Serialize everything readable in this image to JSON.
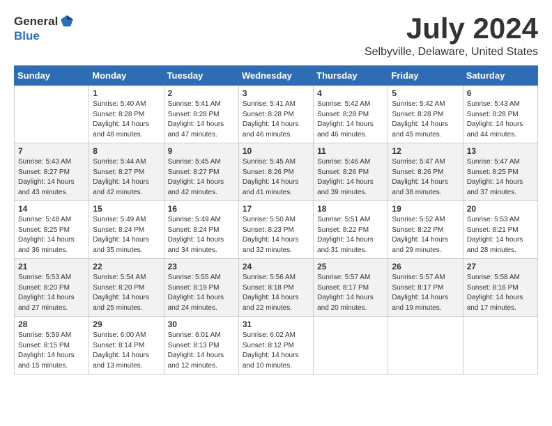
{
  "header": {
    "logo_general": "General",
    "logo_blue": "Blue",
    "month": "July 2024",
    "location": "Selbyville, Delaware, United States"
  },
  "weekdays": [
    "Sunday",
    "Monday",
    "Tuesday",
    "Wednesday",
    "Thursday",
    "Friday",
    "Saturday"
  ],
  "weeks": [
    [
      {
        "day": "",
        "info": ""
      },
      {
        "day": "1",
        "info": "Sunrise: 5:40 AM\nSunset: 8:28 PM\nDaylight: 14 hours\nand 48 minutes."
      },
      {
        "day": "2",
        "info": "Sunrise: 5:41 AM\nSunset: 8:28 PM\nDaylight: 14 hours\nand 47 minutes."
      },
      {
        "day": "3",
        "info": "Sunrise: 5:41 AM\nSunset: 8:28 PM\nDaylight: 14 hours\nand 46 minutes."
      },
      {
        "day": "4",
        "info": "Sunrise: 5:42 AM\nSunset: 8:28 PM\nDaylight: 14 hours\nand 46 minutes."
      },
      {
        "day": "5",
        "info": "Sunrise: 5:42 AM\nSunset: 8:28 PM\nDaylight: 14 hours\nand 45 minutes."
      },
      {
        "day": "6",
        "info": "Sunrise: 5:43 AM\nSunset: 8:28 PM\nDaylight: 14 hours\nand 44 minutes."
      }
    ],
    [
      {
        "day": "7",
        "info": "Sunrise: 5:43 AM\nSunset: 8:27 PM\nDaylight: 14 hours\nand 43 minutes."
      },
      {
        "day": "8",
        "info": "Sunrise: 5:44 AM\nSunset: 8:27 PM\nDaylight: 14 hours\nand 42 minutes."
      },
      {
        "day": "9",
        "info": "Sunrise: 5:45 AM\nSunset: 8:27 PM\nDaylight: 14 hours\nand 42 minutes."
      },
      {
        "day": "10",
        "info": "Sunrise: 5:45 AM\nSunset: 8:26 PM\nDaylight: 14 hours\nand 41 minutes."
      },
      {
        "day": "11",
        "info": "Sunrise: 5:46 AM\nSunset: 8:26 PM\nDaylight: 14 hours\nand 39 minutes."
      },
      {
        "day": "12",
        "info": "Sunrise: 5:47 AM\nSunset: 8:26 PM\nDaylight: 14 hours\nand 38 minutes."
      },
      {
        "day": "13",
        "info": "Sunrise: 5:47 AM\nSunset: 8:25 PM\nDaylight: 14 hours\nand 37 minutes."
      }
    ],
    [
      {
        "day": "14",
        "info": "Sunrise: 5:48 AM\nSunset: 8:25 PM\nDaylight: 14 hours\nand 36 minutes."
      },
      {
        "day": "15",
        "info": "Sunrise: 5:49 AM\nSunset: 8:24 PM\nDaylight: 14 hours\nand 35 minutes."
      },
      {
        "day": "16",
        "info": "Sunrise: 5:49 AM\nSunset: 8:24 PM\nDaylight: 14 hours\nand 34 minutes."
      },
      {
        "day": "17",
        "info": "Sunrise: 5:50 AM\nSunset: 8:23 PM\nDaylight: 14 hours\nand 32 minutes."
      },
      {
        "day": "18",
        "info": "Sunrise: 5:51 AM\nSunset: 8:22 PM\nDaylight: 14 hours\nand 31 minutes."
      },
      {
        "day": "19",
        "info": "Sunrise: 5:52 AM\nSunset: 8:22 PM\nDaylight: 14 hours\nand 29 minutes."
      },
      {
        "day": "20",
        "info": "Sunrise: 5:53 AM\nSunset: 8:21 PM\nDaylight: 14 hours\nand 28 minutes."
      }
    ],
    [
      {
        "day": "21",
        "info": "Sunrise: 5:53 AM\nSunset: 8:20 PM\nDaylight: 14 hours\nand 27 minutes."
      },
      {
        "day": "22",
        "info": "Sunrise: 5:54 AM\nSunset: 8:20 PM\nDaylight: 14 hours\nand 25 minutes."
      },
      {
        "day": "23",
        "info": "Sunrise: 5:55 AM\nSunset: 8:19 PM\nDaylight: 14 hours\nand 24 minutes."
      },
      {
        "day": "24",
        "info": "Sunrise: 5:56 AM\nSunset: 8:18 PM\nDaylight: 14 hours\nand 22 minutes."
      },
      {
        "day": "25",
        "info": "Sunrise: 5:57 AM\nSunset: 8:17 PM\nDaylight: 14 hours\nand 20 minutes."
      },
      {
        "day": "26",
        "info": "Sunrise: 5:57 AM\nSunset: 8:17 PM\nDaylight: 14 hours\nand 19 minutes."
      },
      {
        "day": "27",
        "info": "Sunrise: 5:58 AM\nSunset: 8:16 PM\nDaylight: 14 hours\nand 17 minutes."
      }
    ],
    [
      {
        "day": "28",
        "info": "Sunrise: 5:59 AM\nSunset: 8:15 PM\nDaylight: 14 hours\nand 15 minutes."
      },
      {
        "day": "29",
        "info": "Sunrise: 6:00 AM\nSunset: 8:14 PM\nDaylight: 14 hours\nand 13 minutes."
      },
      {
        "day": "30",
        "info": "Sunrise: 6:01 AM\nSunset: 8:13 PM\nDaylight: 14 hours\nand 12 minutes."
      },
      {
        "day": "31",
        "info": "Sunrise: 6:02 AM\nSunset: 8:12 PM\nDaylight: 14 hours\nand 10 minutes."
      },
      {
        "day": "",
        "info": ""
      },
      {
        "day": "",
        "info": ""
      },
      {
        "day": "",
        "info": ""
      }
    ]
  ]
}
